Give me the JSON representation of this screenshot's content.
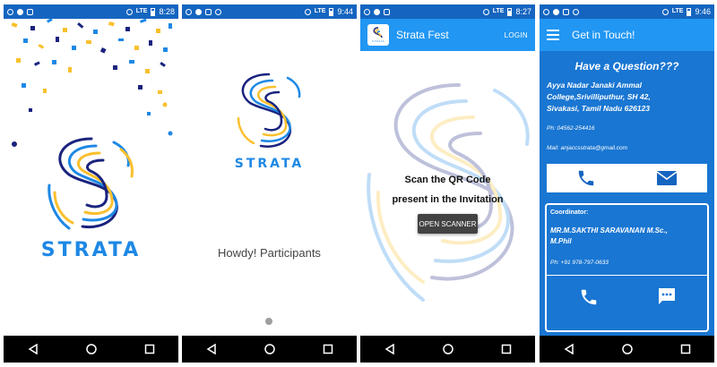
{
  "status": {
    "p1_time": "8:28",
    "p2_time": "9:44",
    "p3_time": "8:27",
    "p4_time": "9:46",
    "network": "LTE"
  },
  "screen1": {
    "brand": "STRATA"
  },
  "screen2": {
    "brand": "STRATA",
    "greeting": "Howdy! Participants"
  },
  "screen3": {
    "app_title": "Strata Fest",
    "login_label": "LOGIN",
    "logo_text": "STRATA",
    "instruction_line1": "Scan the QR Code",
    "instruction_line2": "present in the Invitation",
    "scanner_button": "OPEN SCANNER"
  },
  "screen4": {
    "app_title": "Get in Touch!",
    "heading": "Have a Question???",
    "address_line1": "Ayya Nadar Janaki Ammal",
    "address_line2": "College,Srivilliputhur, SH 42,",
    "address_line3": "Sivakasi, Tamil Nadu 626123",
    "phone": "Ph: 04562-254416",
    "mail": "Mail: anjaccsstrata@gmail.com",
    "coordinator_label": "Coordinator:",
    "coordinator_name_line1": "MR.M.SAKTHI SARAVANAN  M.Sc.,",
    "coordinator_name_line2": "M.Phil",
    "coordinator_phone": "Ph: +91 978-797-0633"
  },
  "colors": {
    "primary": "#2196f3",
    "status_bar": "#1565c0",
    "contact_bg": "#1976d2",
    "logo_blue": "#1e88e5",
    "logo_navy": "#1a237e",
    "logo_yellow": "#f9c02d"
  }
}
